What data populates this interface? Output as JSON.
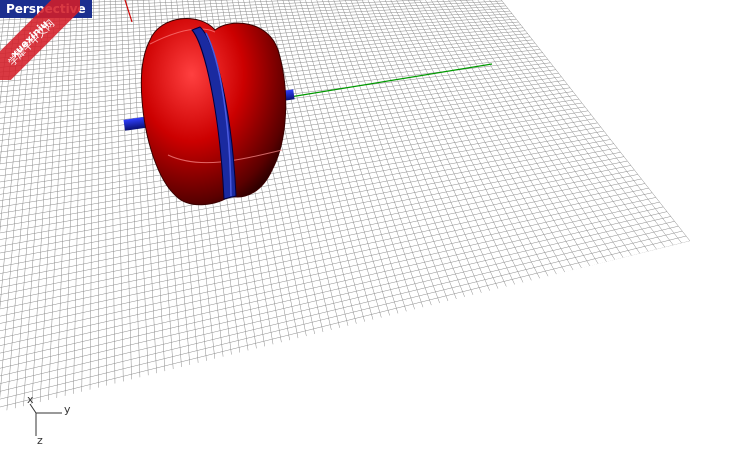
{
  "viewport": {
    "title": "Perspective"
  },
  "watermark": {
    "line1": "xuexiniu",
    "line2": "学犀牛中文网"
  },
  "axis_icon": {
    "x_label": "x",
    "y_label": "y",
    "z_label": "z"
  },
  "colors": {
    "grid_line": "#8c8c8c",
    "x_axis": "#cc0000",
    "y_axis": "#009900",
    "wheel": "#cc0000",
    "axle": "#1020c0",
    "label_bg": "#1b2f8f"
  }
}
